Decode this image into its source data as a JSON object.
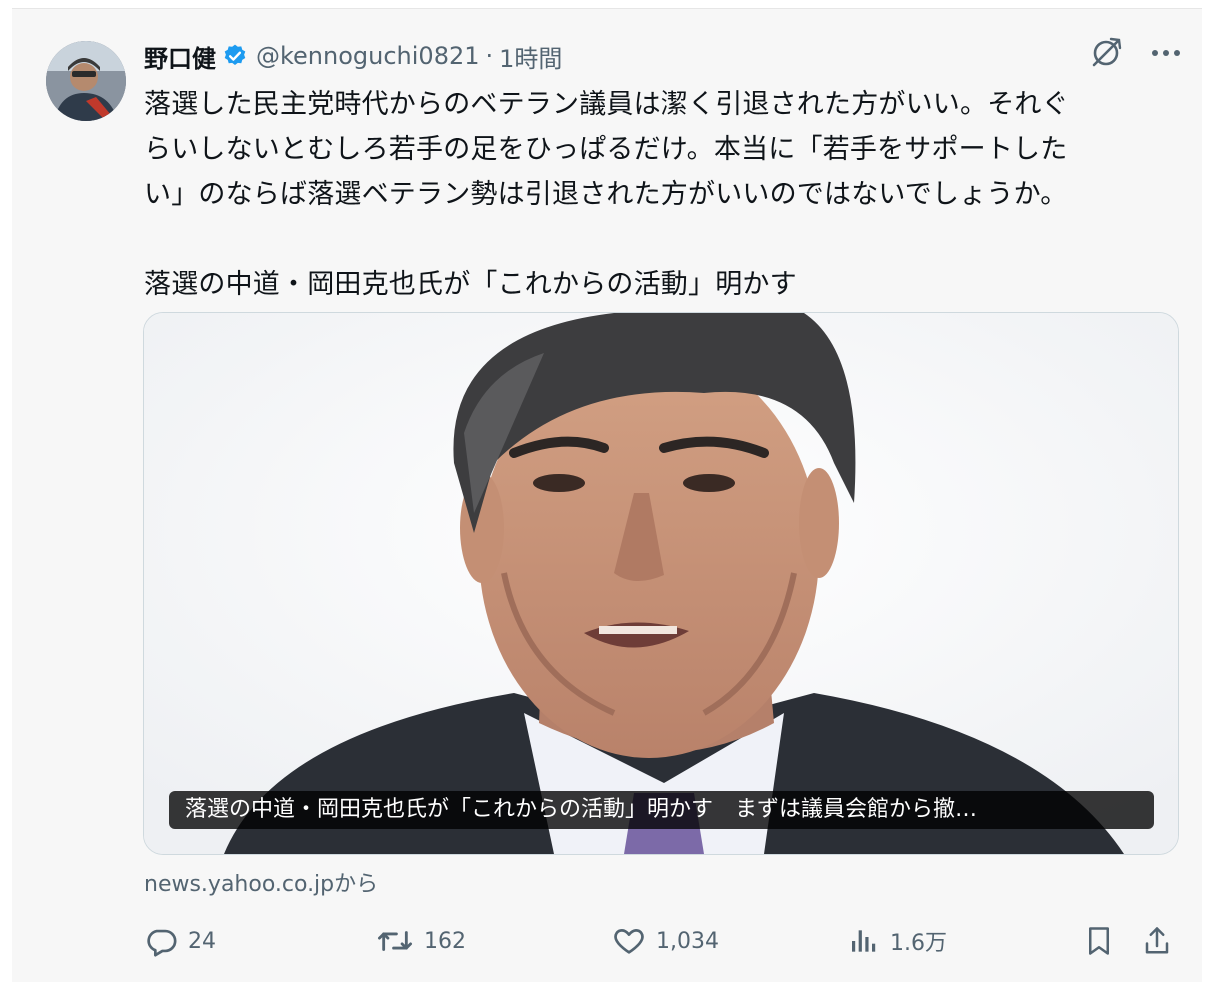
{
  "author": {
    "name": "野口健",
    "handle": "@kennoguchi0821",
    "separator": "·",
    "time": "1時間",
    "verified_color": "#1d9bf0"
  },
  "tweet": {
    "line1": "落選した民主党時代からのベテラン議員は潔く引退された方がいい。それぐ",
    "line2": "らいしないとむしろ若手の足をひっぱるだけ。本当に「若手をサポートした",
    "line3": "い」のならば落選ベテラン勢は引退された方がいいのではないでしょうか。",
    "line4": "落選の中道・岡田克也氏が「これからの活動」明かす"
  },
  "card": {
    "caption": "落選の中道・岡田克也氏が「これからの活動」明かす　まずは議員会館から撤…",
    "source": "news.yahoo.co.jpから"
  },
  "actions": {
    "replies": "24",
    "reposts": "162",
    "likes": "1,034",
    "views": "1.6万"
  },
  "icons": {
    "grok": "grok-icon",
    "more": "more-icon",
    "reply": "reply-icon",
    "repost": "repost-icon",
    "like": "heart-icon",
    "views": "views-icon",
    "bookmark": "bookmark-icon",
    "share": "share-icon"
  }
}
